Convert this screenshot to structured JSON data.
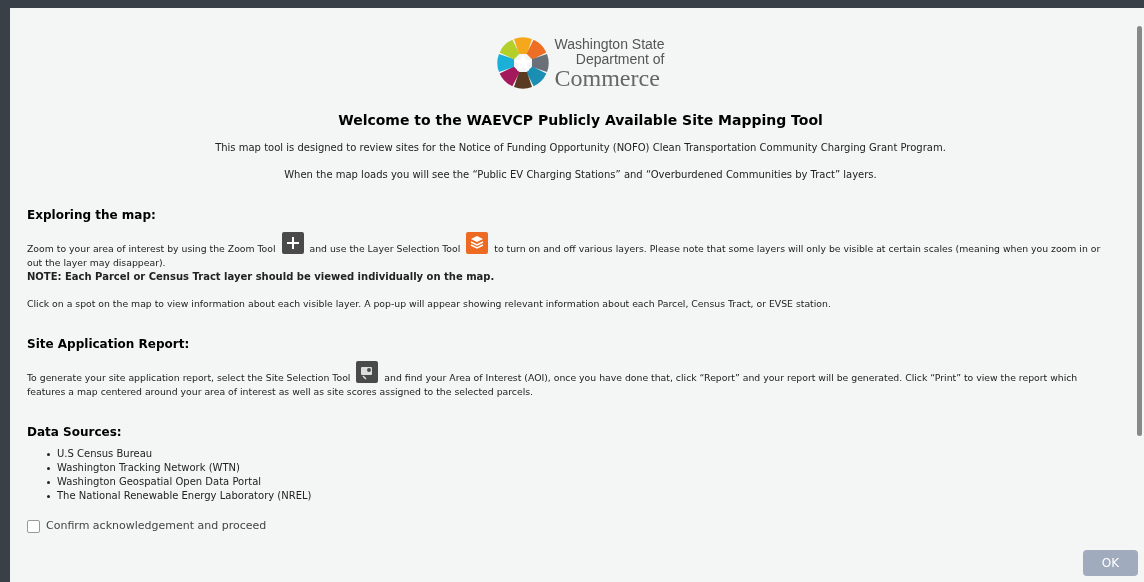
{
  "logo": {
    "line_1": "Washington State",
    "line_2": "Department of",
    "line_3": "Commerce"
  },
  "title": "Welcome to the WAEVCP Publicly Available Site Mapping Tool",
  "intro": [
    "This map tool is designed to review sites for the Notice of Funding Opportunity (NOFO) Clean Transportation Community Charging Grant Program.",
    "When the map loads you will see the “Public EV Charging Stations” and “Overburdened Communities by Tract” layers."
  ],
  "sections": [
    {
      "heading": "Exploring the map:",
      "paragraphs": [
        {
          "parts": [
            {
              "kind": "text",
              "text": "Zoom to your area of interest by using the Zoom Tool"
            },
            {
              "kind": "zoom-tool"
            },
            {
              "kind": "text",
              "text": "and use the Layer Selection Tool"
            },
            {
              "kind": "layer-tool"
            },
            {
              "kind": "text",
              "text": "to turn on and off various layers. Please note that some layers will only be visible at certain scales (meaning when you zoom in or"
            },
            {
              "kind": "line-break"
            },
            {
              "kind": "text",
              "text": "out the layer may disappear)."
            }
          ],
          "note": "NOTE: Each Parcel or Census Tract layer should be viewed individually on the map."
        },
        {
          "parts": [
            {
              "kind": "text",
              "text": "Click on a spot on the map to view information about each visible layer. A pop-up will appear showing relevant information about each Parcel, Census Tract, or EVSE station."
            }
          ]
        }
      ]
    },
    {
      "heading": "Site Application Report:",
      "paragraphs": [
        {
          "parts": [
            {
              "kind": "text",
              "text": "To generate your site application report, select the Site Selection Tool"
            },
            {
              "kind": "site-tool"
            },
            {
              "kind": "text",
              "text": "and find your Area of Interest (AOI), once you have done that, click “Report” and your report will be generated. Click “Print” to view the report which"
            },
            {
              "kind": "line-break"
            },
            {
              "kind": "text",
              "text": "features a map centered around your area of interest as well as site scores assigned to the selected parcels."
            }
          ]
        }
      ]
    },
    {
      "heading": "Data Sources:",
      "list": [
        "U.S Census Bureau",
        "Washington Tracking Network (WTN)",
        "Washington Geospatial Open Data Portal",
        "The National Renewable Energy Laboratory (NREL)"
      ]
    }
  ],
  "acknowledge": {
    "label": "Confirm acknowledgement and proceed",
    "checked": false
  },
  "ok_button": {
    "label": "OK",
    "disabled": true
  }
}
